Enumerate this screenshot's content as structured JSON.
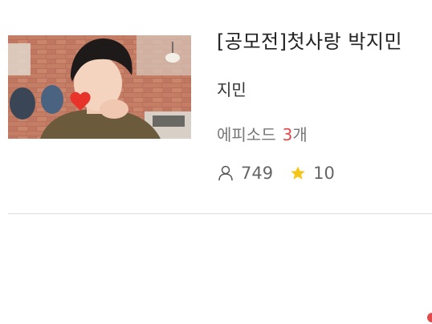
{
  "item": {
    "title": "[공모전]첫사랑 박지민",
    "author": "지민",
    "episodes_label": "에피소드",
    "episodes_count": "3",
    "episodes_unit": "개",
    "views": "749",
    "rating": "10"
  },
  "icons": {
    "views": "person-icon",
    "rating": "star-icon"
  },
  "colors": {
    "accent": "#e24a4a",
    "star": "#f5c518",
    "text_muted": "#777777"
  }
}
